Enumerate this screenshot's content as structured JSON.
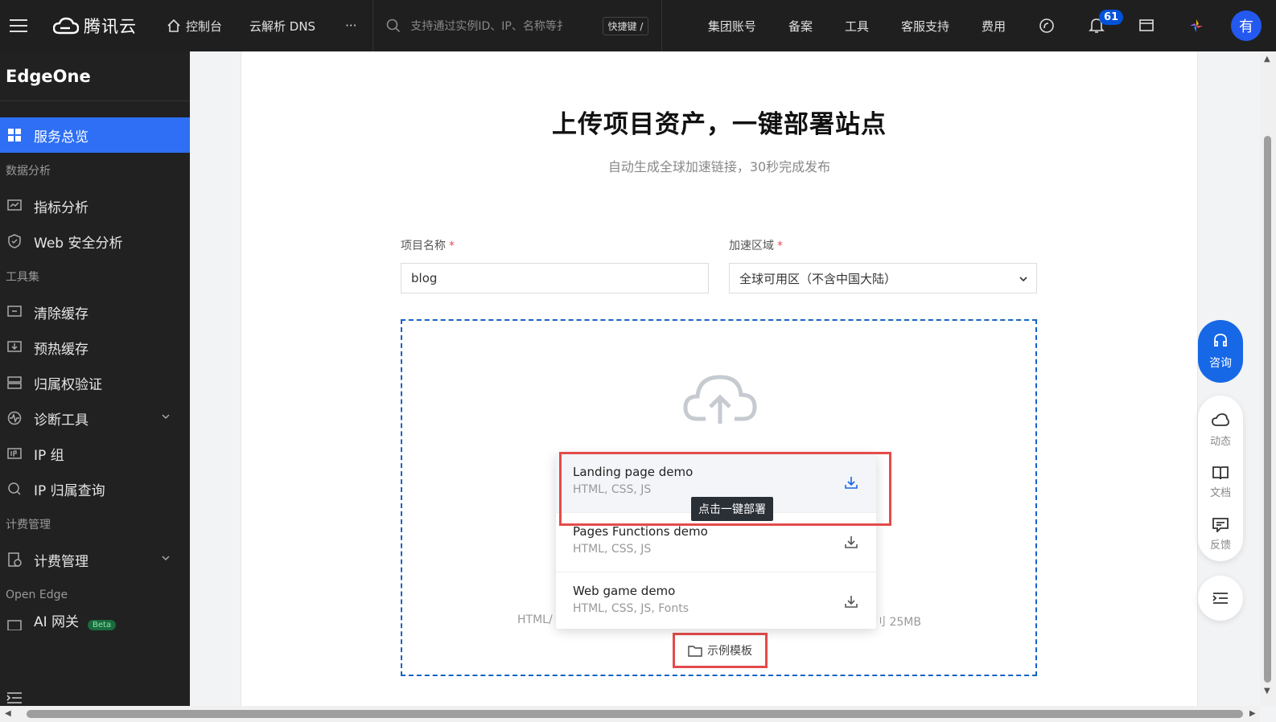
{
  "topbar": {
    "brand": "腾讯云",
    "console": "控制台",
    "dns": "云解析 DNS",
    "more": "···",
    "search_placeholder": "支持通过实例ID、IP、名称等扌",
    "shortcut": "快捷键 /",
    "links": [
      "集团账号",
      "备案",
      "工具",
      "客服支持",
      "费用"
    ],
    "notifications": "61",
    "avatar": "有"
  },
  "sidebar": {
    "title": "EdgeOne",
    "overview": "服务总览",
    "group_data": "数据分析",
    "metric": "指标分析",
    "websec": "Web 安全分析",
    "group_tools": "工具集",
    "purge": "清除缓存",
    "prefetch": "预热缓存",
    "ownership": "归属权验证",
    "diagnose": "诊断工具",
    "ipgroup": "IP 组",
    "iplookup": "IP 归属查询",
    "group_billing": "计费管理",
    "billing": "计费管理",
    "group_open": "Open Edge",
    "ai_gateway": "AI 网关",
    "beta": "Beta"
  },
  "main": {
    "title": "上传项目资产，一键部署站点",
    "subtitle": "自动生成全球加速链接，30秒完成发布",
    "project_label": "项目名称",
    "project_value": "blog",
    "region_label": "加速区域",
    "region_value": "全球可用区（不含中国大陆）",
    "hint_left": "HTML/",
    "hint_right": "刂 25MB",
    "template_button": "示例模板",
    "tooltip": "点击一键部署",
    "templates": [
      {
        "name": "Landing page demo",
        "tags": "HTML, CSS, JS"
      },
      {
        "name": "Pages Functions demo",
        "tags": "HTML, CSS, JS"
      },
      {
        "name": "Web game demo",
        "tags": "HTML, CSS, JS, Fonts"
      }
    ]
  },
  "float": {
    "ask": "咨询",
    "news": "动态",
    "docs": "文档",
    "feedback": "反馈"
  }
}
